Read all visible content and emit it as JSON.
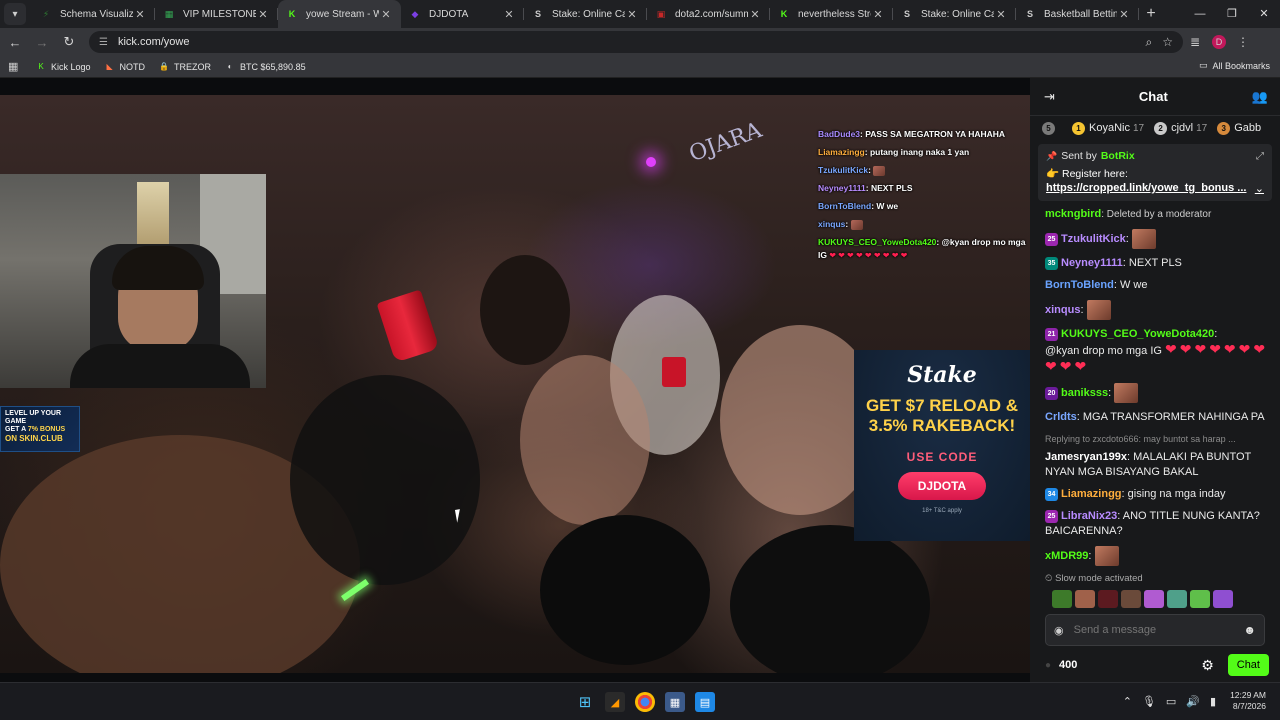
{
  "tabs": [
    {
      "title": "Schema Visualizer | D",
      "favicon_color": "#2e7d32",
      "glyph": "⚡",
      "active": false
    },
    {
      "title": "VIP MILESTONE - Go",
      "favicon_color": "#34a853",
      "glyph": "▦",
      "active": false
    },
    {
      "title": "yowe Stream - W",
      "favicon_color": "#53fc18",
      "glyph": "K",
      "active": true
    },
    {
      "title": "DJDOTA",
      "favicon_color": "#7b3fe4",
      "glyph": "◆",
      "active": false
    },
    {
      "title": "Stake: Online Casino",
      "favicon_color": "#cccccc",
      "glyph": "S",
      "active": false
    },
    {
      "title": "dota2.com/summers",
      "favicon_color": "#c62828",
      "glyph": "▣",
      "active": false
    },
    {
      "title": "nevertheless Stream",
      "favicon_color": "#53fc18",
      "glyph": "K",
      "active": false
    },
    {
      "title": "Stake: Online Casino",
      "favicon_color": "#cccccc",
      "glyph": "S",
      "active": false
    },
    {
      "title": "Basketball Betting &",
      "favicon_color": "#cccccc",
      "glyph": "S",
      "active": false
    }
  ],
  "address": {
    "url": "kick.com/yowe"
  },
  "profile_initial": "D",
  "bookmarks": [
    {
      "label": "Kick Logo",
      "icon": "kick-icon"
    },
    {
      "label": "NOTD",
      "icon": "notd-icon"
    },
    {
      "label": "TREZOR",
      "icon": "lock-icon"
    },
    {
      "label": "BTC $65,890.85",
      "icon": "btc-icon"
    }
  ],
  "all_bookmarks": "All Bookmarks",
  "video": {
    "neon_sign": "OJARA",
    "skin_ad": {
      "line1": "LEVEL UP YOUR GAME",
      "line2_a": "GET A ",
      "line2_b": "7% BONUS",
      "line3": "ON SKIN.CLUB"
    },
    "stake_ad": {
      "logo": "Stake",
      "headline_1": "GET $7 RELOAD &",
      "headline_2": "3.5% RAKEBACK!",
      "use_code": "USE CODE",
      "code": "DJDOTA",
      "fine": "18+  T&C apply"
    },
    "overlay_chat": [
      {
        "user": "BadDude3",
        "color": "#a98bff",
        "text": ": PASS SA MEGATRON YA HAHAHA"
      },
      {
        "user": "Liamazingg",
        "color": "#ffae3d",
        "text": ": putang inang naka 1 yan"
      },
      {
        "user": "TzukulitKick",
        "color": "#7aa7ff",
        "text": ":"
      },
      {
        "user": "Neyney1111",
        "color": "#b88cff",
        "text": ": NEXT PLS"
      },
      {
        "user": "BornToBlend",
        "color": "#7aa7ff",
        "text": ": W we"
      },
      {
        "user": "xinqus",
        "color": "#7aa7ff",
        "text": ":"
      },
      {
        "user": "KUKUYS_CEO_YoweDota420",
        "color": "#53fc18",
        "text": ": @kyan drop mo mga IG"
      }
    ]
  },
  "chat": {
    "title": "Chat",
    "leaderboard": [
      {
        "rank": "5",
        "name": "",
        "count": "",
        "color": "#7a7a7a"
      },
      {
        "rank": "1",
        "name": "KoyaNic",
        "count": "17",
        "color": "#f5c431"
      },
      {
        "rank": "2",
        "name": "cjdvl",
        "count": "17",
        "color": "#c9c9c9"
      },
      {
        "rank": "3",
        "name": "Gabb",
        "count": "",
        "color": "#d68a3c"
      }
    ],
    "pinned": {
      "sent_by": "Sent by",
      "sender": "BotRix",
      "line1": "👉 Register here:",
      "link": "https://cropped.link/yowe_tg_bonus ..."
    },
    "messages": [
      {
        "user": "mckngbird",
        "color": "#53fc18",
        "text": ": Deleted by a moderator",
        "badge": "",
        "badge_color": "",
        "emote": false,
        "deleted": true
      },
      {
        "user": "TzukulitKick",
        "color": "#b88cff",
        "text": ":",
        "badge": "25",
        "badge_color": "#9c27b0",
        "emote": true
      },
      {
        "user": "Neyney1111",
        "color": "#b88cff",
        "text": ": NEXT PLS",
        "badge": "35",
        "badge_color": "#00897b",
        "emote": false
      },
      {
        "user": "BornToBlend",
        "color": "#6aa3ff",
        "text": ": W we",
        "badge": "",
        "badge_color": "",
        "emote": false
      },
      {
        "user": "xinqus",
        "color": "#b88cff",
        "text": ":",
        "badge": "",
        "badge_color": "",
        "emote": true
      },
      {
        "user": "KUKUYS_CEO_YoweDota420",
        "color": "#53fc18",
        "text": ":",
        "badge": "21",
        "badge_color": "#8e24aa",
        "emote": false,
        "body": "@kyan drop mo mga IG",
        "hearts": "❤❤❤❤❤❤❤❤❤❤"
      },
      {
        "user": "baniksss",
        "color": "#53fc18",
        "text": ":",
        "badge": "20",
        "badge_color": "#6a1b9a",
        "emote": true
      },
      {
        "user": "Crldts",
        "color": "#7aa7ff",
        "text": ": MGA TRANSFORMER NAHINGA PA",
        "badge": "",
        "badge_color": "",
        "emote": false
      },
      {
        "user": "Jamesryan199x",
        "color": "#ffffff",
        "text": ": MALALAKI PA BUNTOT NYAN MGA BISAYANG BAKAL",
        "badge": "",
        "badge_color": "",
        "emote": false,
        "reply": "Replying to zxcdoto666: may buntot sa harap ..."
      },
      {
        "user": "Liamazingg",
        "color": "#ffae3d",
        "text": ": gising na mga inday",
        "badge": "34",
        "badge_color": "#1e88e5",
        "emote": false
      },
      {
        "user": "LibraNix23",
        "color": "#b88cff",
        "text": ": ANO TITLE NUNG KANTA? BAICARENNA?",
        "badge": "25",
        "badge_color": "#9c27b0",
        "emote": false
      },
      {
        "user": "xMDR99",
        "color": "#53fc18",
        "text": ":",
        "badge": "",
        "badge_color": "",
        "emote": true
      }
    ],
    "slow_mode": "Slow mode activated",
    "input_placeholder": "Send a message",
    "points": "400",
    "chat_button": "Chat"
  },
  "taskbar": {
    "time": "12:29 AM",
    "date": "8/7/2026"
  }
}
